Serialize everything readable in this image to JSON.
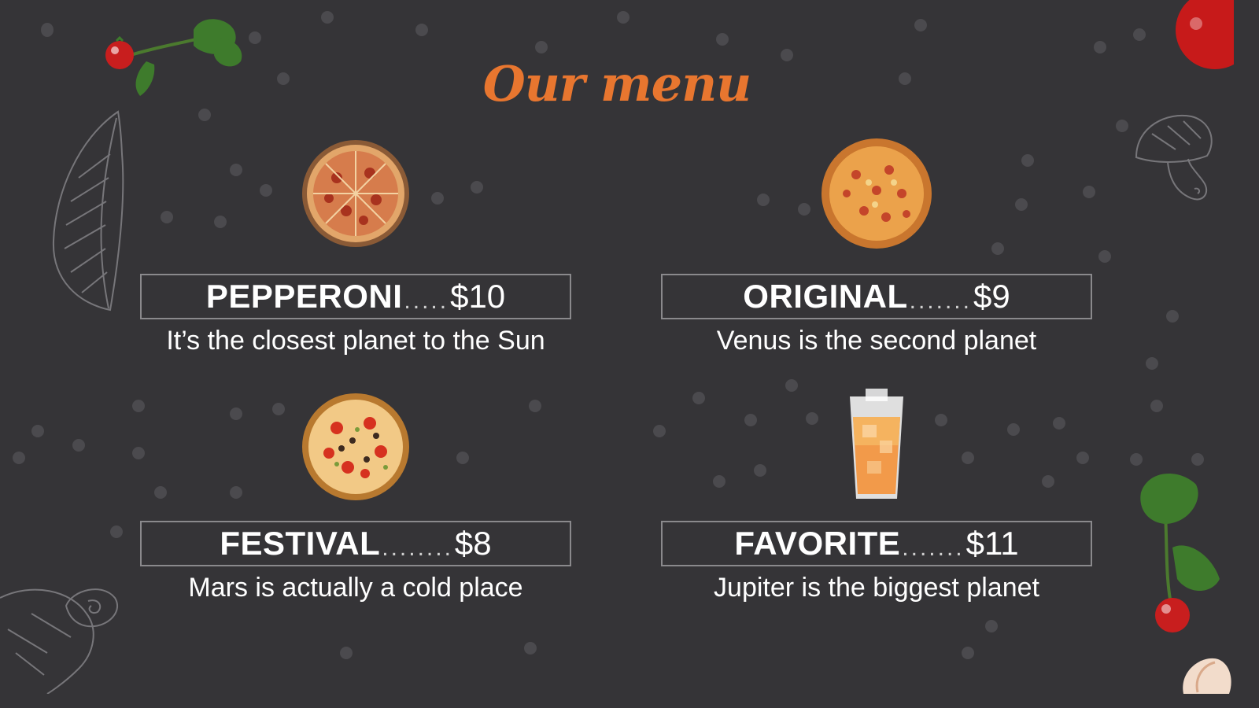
{
  "menu": {
    "title": "Our menu",
    "accent_color": "#e8762f",
    "items": [
      {
        "name": "PEPPERONI",
        "leader": ".....",
        "price": "$10",
        "description": "It’s the closest planet to the Sun",
        "icon": "pepperoni-pizza-icon"
      },
      {
        "name": "ORIGINAL",
        "leader": ".......",
        "price": "$9",
        "description": "Venus is the second planet",
        "icon": "original-pizza-icon"
      },
      {
        "name": "FESTIVAL",
        "leader": "........",
        "price": "$8",
        "description": "Mars is actually a cold place",
        "icon": "festival-pizza-icon"
      },
      {
        "name": "FAVORITE",
        "leader": ".......",
        "price": "$11",
        "description": "Jupiter is the biggest planet",
        "icon": "juice-glass-icon"
      }
    ]
  }
}
